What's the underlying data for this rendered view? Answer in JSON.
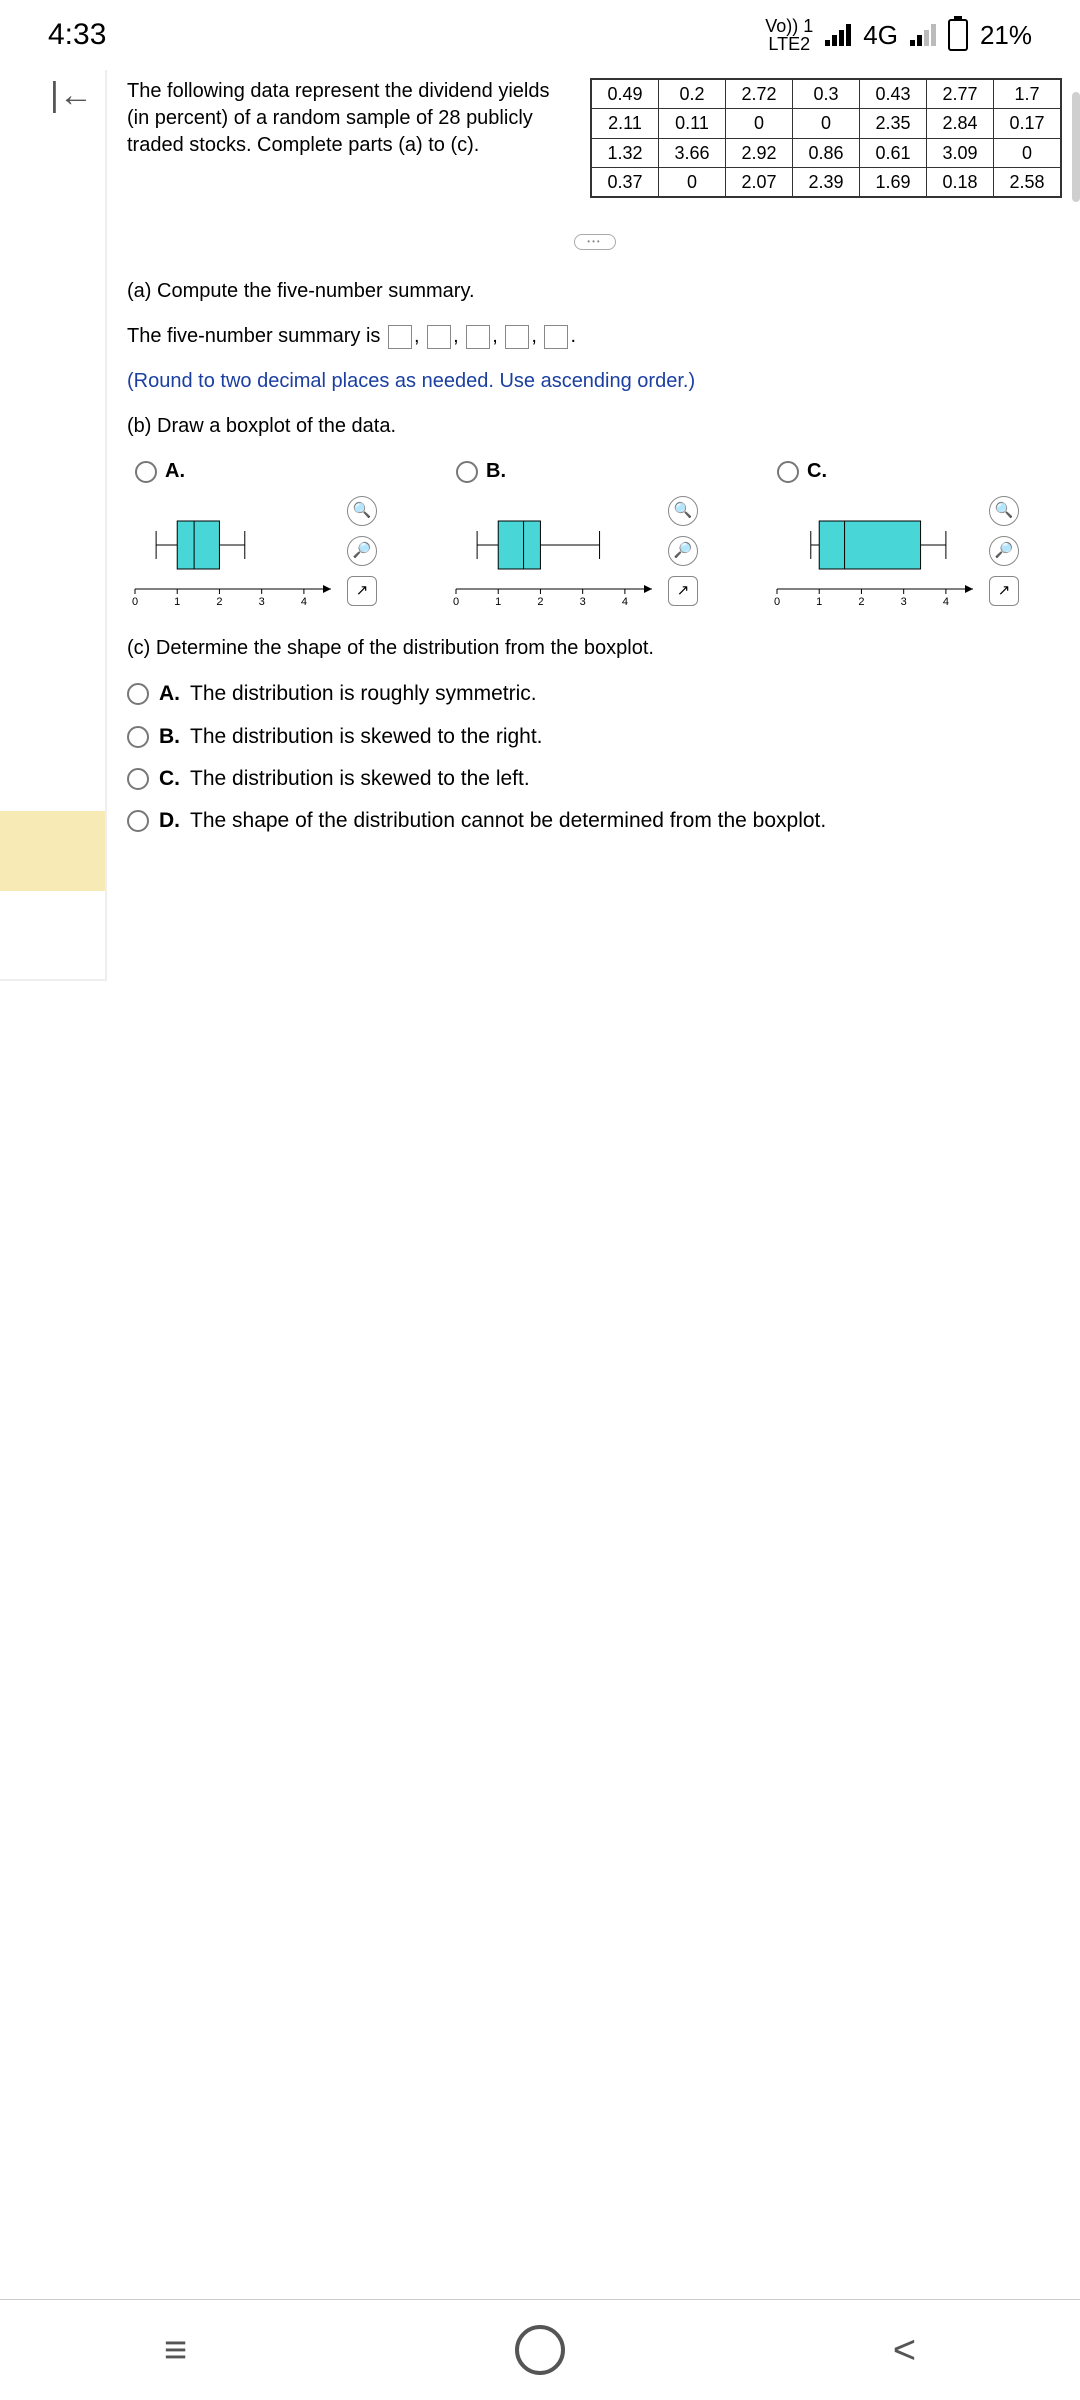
{
  "status": {
    "time": "4:33",
    "volte": "Vo)) 1\nLTE2",
    "net": "4G",
    "battery": "21%"
  },
  "intro": "The following data represent  the dividend yields (in percent) of a random sample of 28 publicly traded stocks. Complete parts (a) to (c).",
  "table": [
    [
      "0.49",
      "0.2",
      "2.72",
      "0.3",
      "0.43",
      "2.77",
      "1.7"
    ],
    [
      "2.11",
      "0.11",
      "0",
      "0",
      "2.35",
      "2.84",
      "0.17"
    ],
    [
      "1.32",
      "3.66",
      "2.92",
      "0.86",
      "0.61",
      "3.09",
      "0"
    ],
    [
      "0.37",
      "0",
      "2.07",
      "2.39",
      "1.69",
      "0.18",
      "2.58"
    ]
  ],
  "a": {
    "prompt": "(a) Compute the five-number summary.",
    "line": "The five-number summary is ",
    "hint": "(Round to two decimal places as needed. Use ascending order.)"
  },
  "b": {
    "prompt": "(b) Draw a boxplot of the data.",
    "opts": [
      "A.",
      "B.",
      "C."
    ],
    "axis": [
      "0",
      "1",
      "2",
      "3",
      "4"
    ]
  },
  "c": {
    "prompt": "(c) Determine the shape of the distribution from the boxplot.",
    "opts": [
      {
        "k": "A.",
        "t": "The distribution is roughly symmetric."
      },
      {
        "k": "B.",
        "t": "The distribution is skewed to the right."
      },
      {
        "k": "C.",
        "t": "The distribution is skewed to the left."
      },
      {
        "k": "D.",
        "t": "The shape of the distribution cannot be determined from the boxplot."
      }
    ]
  },
  "chart_data": [
    {
      "type": "boxplot",
      "label": "A",
      "min": 0.5,
      "q1": 1.0,
      "median": 1.4,
      "q3": 2.0,
      "max": 2.6,
      "xlim": [
        0,
        4.5
      ]
    },
    {
      "type": "boxplot",
      "label": "B",
      "min": 0.5,
      "q1": 1.0,
      "median": 1.6,
      "q3": 2.0,
      "max": 3.4,
      "xlim": [
        0,
        4.5
      ]
    },
    {
      "type": "boxplot",
      "label": "C",
      "min": 0.8,
      "q1": 1.0,
      "median": 1.6,
      "q3": 3.4,
      "max": 4.0,
      "xlim": [
        0,
        4.5
      ]
    }
  ]
}
